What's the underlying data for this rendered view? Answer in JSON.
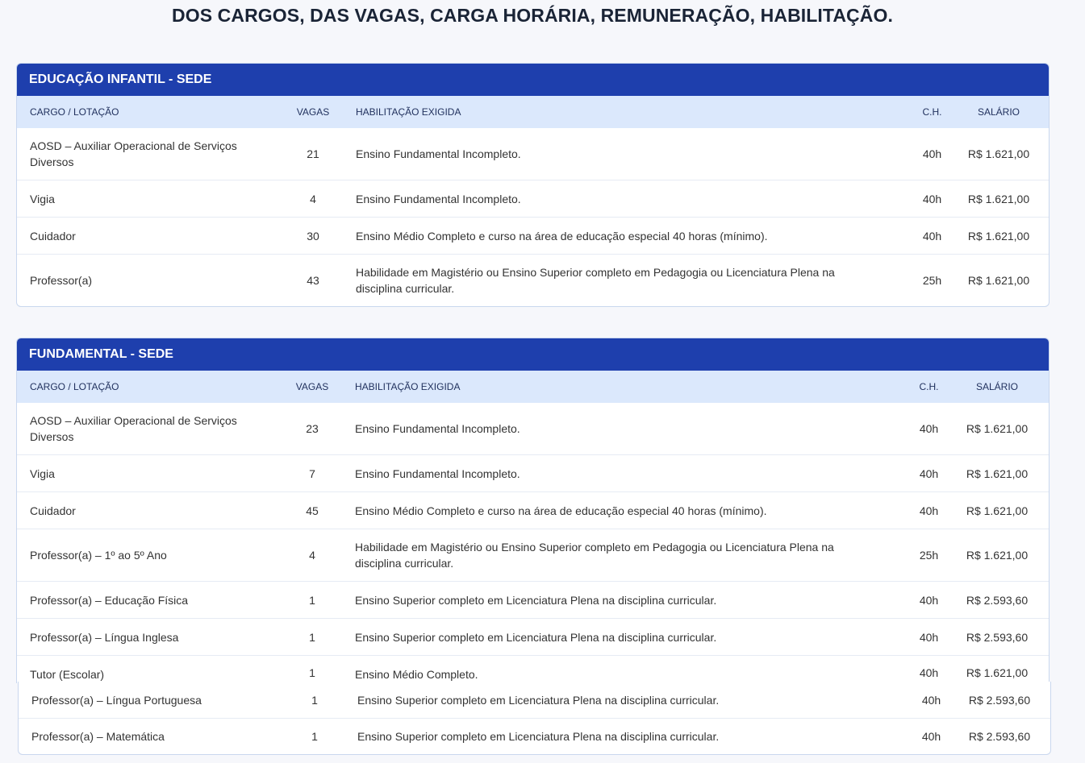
{
  "page_title": "DOS CARGOS, DAS VAGAS, CARGA HORÁRIA, REMUNERAÇÃO, HABILITAÇÃO.",
  "columns": {
    "cargo": "CARGO / LOTAÇÃO",
    "vagas": "VAGAS",
    "habilitacao": "HABILITAÇÃO EXIGIDA",
    "ch": "C.H.",
    "salario": "SALÁRIO"
  },
  "section1": {
    "title": "EDUCAÇÃO INFANTIL - SEDE",
    "rows": [
      {
        "cargo": "AOSD – Auxiliar Operacional de Serviços Diversos",
        "vagas": "21",
        "habilitacao": "Ensino Fundamental Incompleto.",
        "ch": "40h",
        "salario": "R$ 1.621,00"
      },
      {
        "cargo": "Vigia",
        "vagas": "4",
        "habilitacao": "Ensino Fundamental Incompleto.",
        "ch": "40h",
        "salario": "R$ 1.621,00"
      },
      {
        "cargo": "Cuidador",
        "vagas": "30",
        "habilitacao": "Ensino Médio Completo e curso na área de educação especial 40 horas (mínimo).",
        "ch": "40h",
        "salario": "R$ 1.621,00"
      },
      {
        "cargo": "Professor(a)",
        "vagas": "43",
        "habilitacao": "Habilidade em Magistério ou Ensino Superior completo em Pedagogia ou Licenciatura Plena na disciplina curricular.",
        "ch": "25h",
        "salario": "R$ 1.621,00"
      }
    ]
  },
  "section2": {
    "title": "FUNDAMENTAL - SEDE",
    "rows": [
      {
        "cargo": "AOSD – Auxiliar Operacional de Serviços Diversos",
        "vagas": "23",
        "habilitacao": "Ensino Fundamental Incompleto.",
        "ch": "40h",
        "salario": "R$ 1.621,00"
      },
      {
        "cargo": "Vigia",
        "vagas": "7",
        "habilitacao": "Ensino Fundamental Incompleto.",
        "ch": "40h",
        "salario": "R$ 1.621,00"
      },
      {
        "cargo": "Cuidador",
        "vagas": "45",
        "habilitacao": "Ensino Médio Completo e curso na área de educação especial 40 horas (mínimo).",
        "ch": "40h",
        "salario": "R$ 1.621,00"
      },
      {
        "cargo": "Professor(a) – 1º ao 5º Ano",
        "vagas": "4",
        "habilitacao": "Habilidade em Magistério ou Ensino Superior completo em Pedagogia ou Licenciatura Plena na disciplina curricular.",
        "ch": "25h",
        "salario": "R$ 1.621,00"
      },
      {
        "cargo": "Professor(a) – Educação Física",
        "vagas": "1",
        "habilitacao": "Ensino Superior completo em Licenciatura Plena na disciplina curricular.",
        "ch": "40h",
        "salario": "R$ 2.593,60"
      },
      {
        "cargo": "Professor(a) – Língua Inglesa",
        "vagas": "1",
        "habilitacao": "Ensino Superior completo em Licenciatura Plena na disciplina curricular.",
        "ch": "40h",
        "salario": "R$ 2.593,60"
      },
      {
        "cargo": "Tutor (Escolar)",
        "vagas": "1",
        "habilitacao": "Ensino Médio Completo.",
        "ch": "40h",
        "salario": "R$ 1.621,00"
      }
    ],
    "extra_rows": [
      {
        "cargo": "Professor(a) – Língua Portuguesa",
        "vagas": "1",
        "habilitacao": "Ensino Superior completo em Licenciatura Plena na disciplina curricular.",
        "ch": "40h",
        "salario": "R$ 2.593,60"
      },
      {
        "cargo": "Professor(a) – Matemática",
        "vagas": "1",
        "habilitacao": "Ensino Superior completo em Licenciatura Plena na disciplina curricular.",
        "ch": "40h",
        "salario": "R$ 2.593,60"
      }
    ]
  }
}
